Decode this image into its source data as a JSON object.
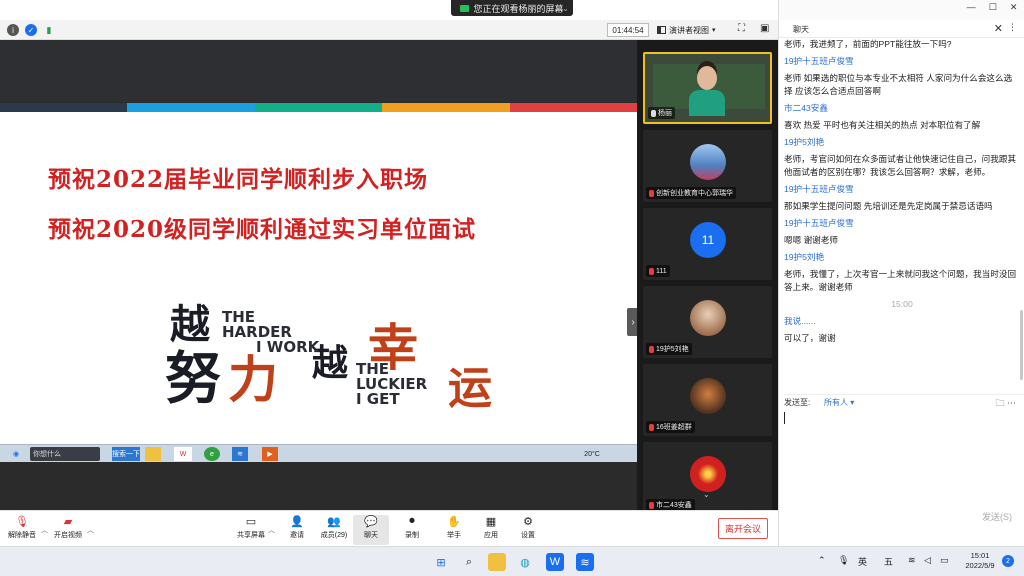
{
  "share_banner": {
    "text": "您正在观看杨丽的屏幕"
  },
  "topbar": {
    "timer": "01:44:54",
    "view_label": "演讲者视图"
  },
  "slide": {
    "line1": "预祝2022届毕业同学顺利步入职场",
    "line2": "预祝2020级同学顺利通过实习单位面试",
    "slogan_chars": [
      "越",
      "努",
      "力",
      "越",
      "幸",
      "运"
    ],
    "slogan_en1": [
      "THE",
      "HARDER",
      "I WORK"
    ],
    "slogan_en2": [
      "THE",
      "LUCKIER",
      "I GET"
    ],
    "stripe_colors": [
      "#2b3a4a",
      "#1aa0e0",
      "#12b08a",
      "#f0a020",
      "#e04040"
    ]
  },
  "inner_taskbar": {
    "search": "你想什么",
    "button": "搜索一下",
    "tray_time": "20°C"
  },
  "participants": [
    {
      "name": "杨丽",
      "muted": false,
      "type": "video"
    },
    {
      "name": "创新创业教育中心郭瑞华",
      "muted": true,
      "type": "avatar",
      "color": "#5080c0"
    },
    {
      "name": "111",
      "muted": true,
      "type": "number",
      "initial": "11"
    },
    {
      "name": "19护5刘艳",
      "muted": true,
      "type": "avatar",
      "color": "#c09070"
    },
    {
      "name": "16班姜超群",
      "muted": true,
      "type": "avatar",
      "color": "#b05030"
    },
    {
      "name": "市二43安鑫",
      "muted": true,
      "type": "avatar",
      "color": "#d02020"
    }
  ],
  "toolbar": {
    "mute": "解除静音",
    "video": "开启视频",
    "share": "共享屏幕",
    "invite": "邀请",
    "members": "成员(29)",
    "chat": "聊天",
    "record": "录制",
    "raise": "举手",
    "apps": "应用",
    "settings": "设置",
    "leave": "离开会议"
  },
  "chat": {
    "title": "聊天",
    "messages": [
      {
        "kind": "text",
        "text": "老师，我进频了，前面的PPT能往放一下吗?"
      },
      {
        "kind": "sender",
        "text": "19护十五班卢俊雪"
      },
      {
        "kind": "text",
        "text": "老师 如果选的职位与本专业不太相符  人家问为什么会这么选择  应该怎么合适点回答啊"
      },
      {
        "kind": "sender",
        "text": "市二43安鑫"
      },
      {
        "kind": "text",
        "text": "喜欢 热爱 平时也有关注相关的热点 对本职位有了解"
      },
      {
        "kind": "sender",
        "text": "19护5刘艳"
      },
      {
        "kind": "text",
        "text": "老师，考官问如何在众多面试者让他快速记住自己，问我跟其他面试者的区别在哪？我该怎么回答啊？求解，老师。"
      },
      {
        "kind": "sender",
        "text": "19护十五班卢俊雪"
      },
      {
        "kind": "text",
        "text": "那如果学生提问问题  先培训还是先定岗属于禁忌话语吗"
      },
      {
        "kind": "sender",
        "text": "19护十五班卢俊雪"
      },
      {
        "kind": "text",
        "text": "嗯嗯  谢谢老师"
      },
      {
        "kind": "sender",
        "text": "19护5刘艳"
      },
      {
        "kind": "text",
        "text": "老师，我懂了，上次考官一上来就问我这个问题，我当时没回答上来。谢谢老师"
      },
      {
        "kind": "time",
        "text": "15:00"
      },
      {
        "kind": "sender",
        "text": "我说......"
      },
      {
        "kind": "text",
        "text": "可以了，谢谢"
      }
    ],
    "send_to_label": "发送至:",
    "send_to_value": "所有人",
    "send_button": "发送(S)"
  },
  "taskbar": {
    "lang1": "英",
    "lang2": "五",
    "time": "15:01",
    "date": "2022/5/9",
    "notifications": "2"
  }
}
